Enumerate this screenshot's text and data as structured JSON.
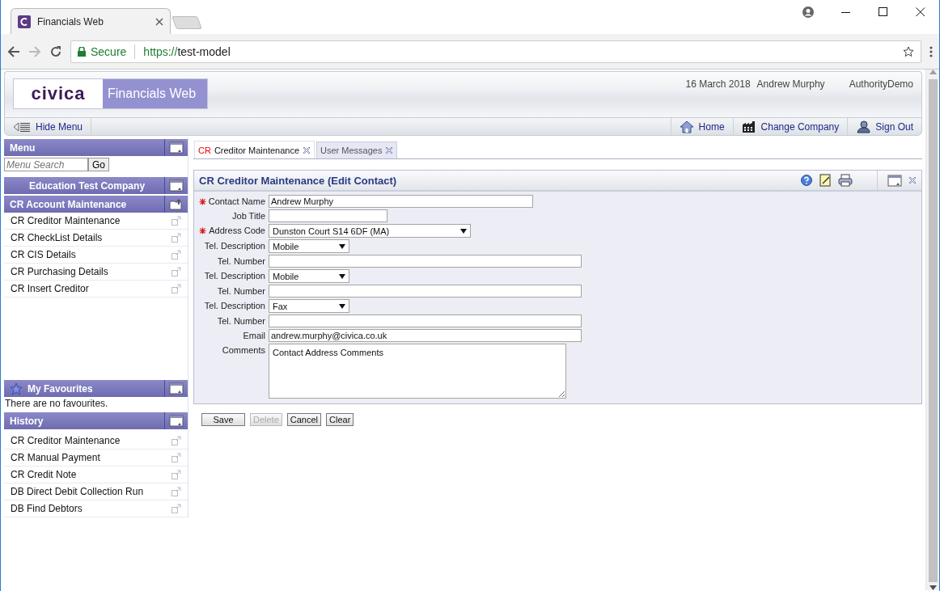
{
  "browser": {
    "tab_title": "Financials Web",
    "address": {
      "security": "Secure",
      "scheme": "https://",
      "host": "test-model"
    }
  },
  "header": {
    "logo": "civica",
    "product": "Financials Web",
    "date": "16 March 2018",
    "user": "Andrew Murphy",
    "database": "AuthorityDemo"
  },
  "toolbar": {
    "hide_menu": "Hide Menu",
    "links": [
      {
        "kind": "home",
        "label": "Home"
      },
      {
        "kind": "company",
        "label": "Change Company"
      },
      {
        "kind": "signout",
        "label": "Sign Out"
      }
    ]
  },
  "sidebar": {
    "menu": {
      "title": "Menu",
      "search_placeholder": "Menu Search",
      "go": "Go"
    },
    "company": "Education Test Company",
    "section": {
      "title": "CR Account Maintenance",
      "items": [
        "CR Creditor Maintenance",
        "CR CheckList Details",
        "CR CIS Details",
        "CR Purchasing Details",
        "CR Insert Creditor"
      ]
    },
    "favourites": {
      "title": "My Favourites",
      "empty": "There are no favourites."
    },
    "history": {
      "title": "History",
      "items": [
        "CR Creditor Maintenance",
        "CR Manual Payment",
        "CR Credit Note",
        "DB Direct Debit Collection Run",
        "DB Find Debtors"
      ]
    }
  },
  "tabs": [
    {
      "code": "CR",
      "label": "Creditor Maintenance",
      "selected": true
    },
    {
      "label": "User Messages",
      "selected": false
    }
  ],
  "form": {
    "title": "CR Creditor Maintenance (Edit Contact)",
    "fields": [
      {
        "kind": "medium",
        "label": "Contact Name",
        "required": true,
        "value": "Andrew Murphy"
      },
      {
        "kind": "short",
        "label": "Job Title",
        "required": false
      },
      {
        "kind": "widecombo",
        "label": "Address Code",
        "required": true,
        "value": "Dunston Court S14 6DF (MA)"
      },
      {
        "kind": "combo",
        "label": "Tel. Description",
        "required": false,
        "value": "Mobile"
      },
      {
        "kind": "long",
        "label": "Tel. Number",
        "required": false
      },
      {
        "kind": "combo",
        "label": "Tel. Description",
        "required": false,
        "value": "Mobile"
      },
      {
        "kind": "long",
        "label": "Tel. Number",
        "required": false
      },
      {
        "kind": "combo",
        "label": "Tel. Description",
        "required": false,
        "value": "Fax"
      },
      {
        "kind": "long",
        "label": "Tel. Number",
        "required": false
      },
      {
        "kind": "long",
        "label": "Email",
        "required": false,
        "value": "andrew.murphy@civica.co.uk"
      },
      {
        "kind": "memo",
        "label": "Comments",
        "required": false,
        "value": "Contact Address Comments"
      }
    ]
  },
  "buttons": [
    {
      "label": "Save",
      "disabled": false
    },
    {
      "label": "Delete",
      "disabled": true
    },
    {
      "label": "Cancel",
      "disabled": false
    },
    {
      "label": "Clear",
      "disabled": false
    }
  ]
}
